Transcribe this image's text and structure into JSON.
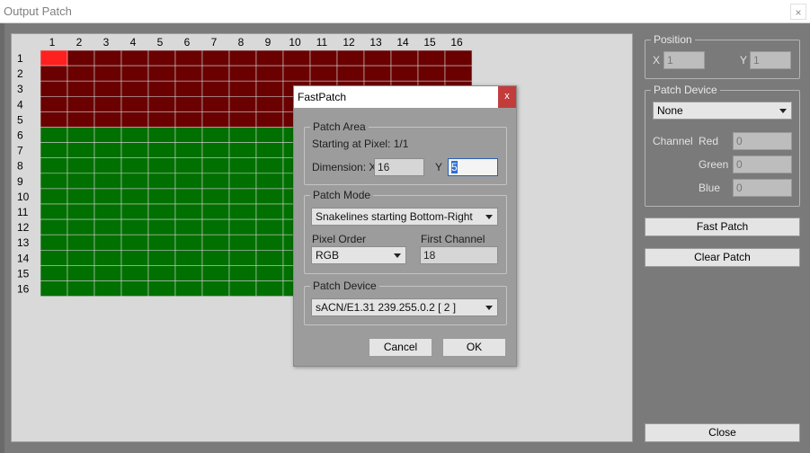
{
  "window": {
    "title": "Output Patch",
    "close_glyph": "×"
  },
  "grid": {
    "col_headers": [
      "1",
      "2",
      "3",
      "4",
      "5",
      "6",
      "7",
      "8",
      "9",
      "10",
      "11",
      "12",
      "13",
      "14",
      "15",
      "16"
    ],
    "row_headers": [
      "1",
      "2",
      "3",
      "4",
      "5",
      "6",
      "7",
      "8",
      "9",
      "10",
      "11",
      "12",
      "13",
      "14",
      "15",
      "16"
    ],
    "patched_rows": 5,
    "selected_cell": {
      "row": 1,
      "col": 1
    },
    "colors": {
      "selected": "#ff2020",
      "patched": "#6a0000",
      "unpatched": "#007000",
      "grid_line": "#cccccc"
    }
  },
  "position": {
    "label": "Position",
    "x_label": "X",
    "x_value": "1",
    "y_label": "Y",
    "y_value": "1"
  },
  "patch_device": {
    "label": "Patch Device",
    "selected": "None",
    "channel_label": "Channel",
    "red_label": "Red",
    "red_value": "0",
    "green_label": "Green",
    "green_value": "0",
    "blue_label": "Blue",
    "blue_value": "0"
  },
  "buttons": {
    "fast_patch": "Fast Patch",
    "clear_patch": "Clear Patch",
    "close": "Close"
  },
  "dialog": {
    "title": "FastPatch",
    "close_glyph": "x",
    "patch_area": {
      "label": "Patch Area",
      "starting_text": "Starting at Pixel: 1/1",
      "dimension_label": "Dimension: X",
      "x_value": "16",
      "y_label": "Y",
      "y_value": "5"
    },
    "patch_mode": {
      "label": "Patch Mode",
      "mode_selected": "Snakelines starting Bottom-Right",
      "pixel_order_label": "Pixel Order",
      "pixel_order_selected": "RGB",
      "first_channel_label": "First Channel",
      "first_channel_value": "18"
    },
    "patch_device": {
      "label": "Patch Device",
      "selected": "sACN/E1.31 239.255.0.2 [ 2 ]"
    },
    "cancel_label": "Cancel",
    "ok_label": "OK"
  }
}
